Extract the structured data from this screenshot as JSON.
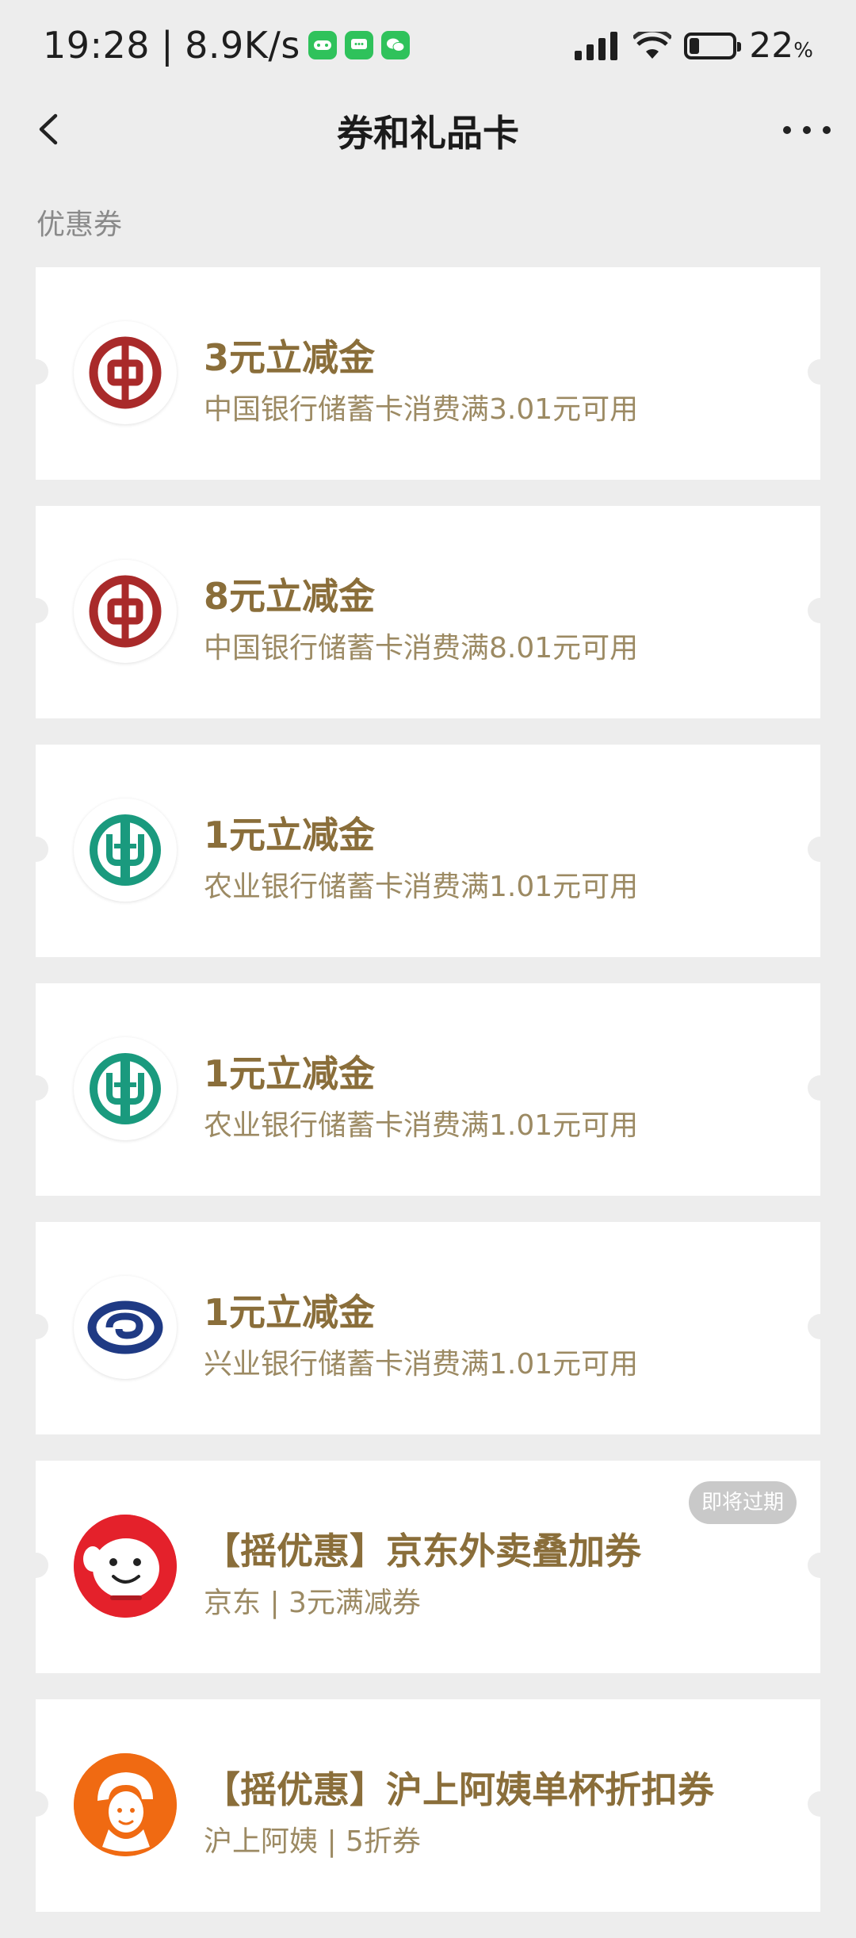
{
  "status_bar": {
    "time": "19:28",
    "speed": "8.9K/s",
    "battery_pct": "22",
    "battery_unit": "%"
  },
  "header": {
    "title": "券和礼品卡"
  },
  "section": {
    "label": "优惠券"
  },
  "coupons": [
    {
      "title": "3元立减金",
      "desc": "中国银行储蓄卡消费满3.01元可用",
      "logo": "boc-logo",
      "badge": ""
    },
    {
      "title": "8元立减金",
      "desc": "中国银行储蓄卡消费满8.01元可用",
      "logo": "boc-logo",
      "badge": ""
    },
    {
      "title": "1元立减金",
      "desc": "农业银行储蓄卡消费满1.01元可用",
      "logo": "abc-logo",
      "badge": ""
    },
    {
      "title": "1元立减金",
      "desc": "农业银行储蓄卡消费满1.01元可用",
      "logo": "abc-logo",
      "badge": ""
    },
    {
      "title": "1元立减金",
      "desc": "兴业银行储蓄卡消费满1.01元可用",
      "logo": "cib-logo",
      "badge": ""
    },
    {
      "title": "【摇优惠】京东外卖叠加券",
      "desc": "京东 | 3元满减券",
      "logo": "jd-logo",
      "badge": "即将过期"
    },
    {
      "title": "【摇优惠】沪上阿姨单杯折扣券",
      "desc": "沪上阿姨 | 5折券",
      "logo": "hushang-logo",
      "badge": ""
    }
  ],
  "colors": {
    "background": "#ededed",
    "coupon_title": "#8a6e3a",
    "coupon_desc": "#9c8a63",
    "boc_red": "#a92a2a",
    "abc_green": "#1a9a7e",
    "cib_blue": "#1f3a84",
    "jd_red": "#e4212b",
    "hushang_orange": "#f06a12"
  }
}
